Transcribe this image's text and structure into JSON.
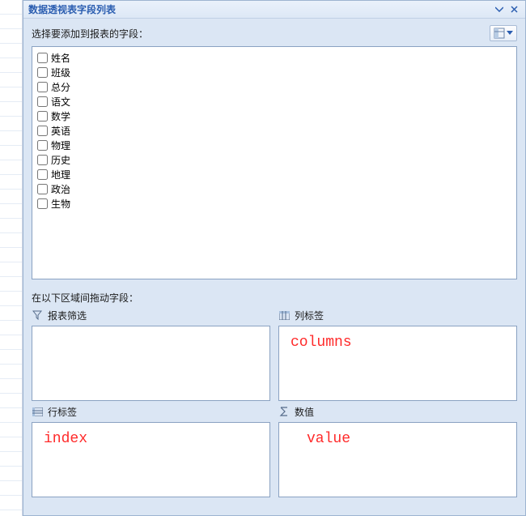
{
  "titlebar": {
    "title": "数据透视表字段列表"
  },
  "instruction": "选择要添加到报表的字段：",
  "fields": [
    {
      "label": "姓名"
    },
    {
      "label": "班级"
    },
    {
      "label": "总分"
    },
    {
      "label": "语文"
    },
    {
      "label": "数学"
    },
    {
      "label": "英语"
    },
    {
      "label": "物理"
    },
    {
      "label": "历史"
    },
    {
      "label": "地理"
    },
    {
      "label": "政治"
    },
    {
      "label": "生物"
    }
  ],
  "drag_instruction": "在以下区域间拖动字段：",
  "areas": {
    "report_filter": {
      "label": "报表筛选"
    },
    "column_labels": {
      "label": "列标签",
      "annotation": "columns"
    },
    "row_labels": {
      "label": "行标签",
      "annotation": "index"
    },
    "values": {
      "label": "数值",
      "annotation": "value"
    }
  }
}
